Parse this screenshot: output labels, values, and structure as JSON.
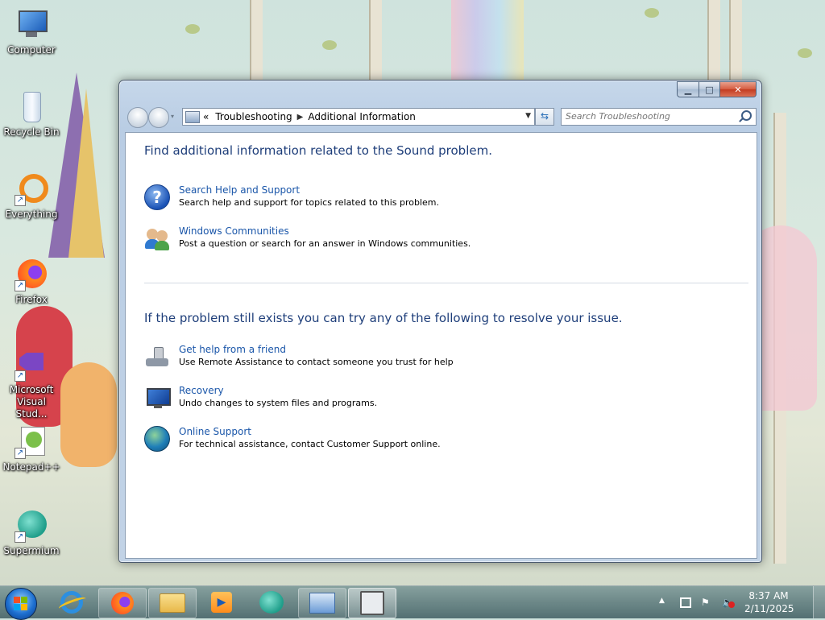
{
  "desktop": {
    "icons": [
      {
        "label": "Computer"
      },
      {
        "label": "Recycle Bin"
      },
      {
        "label": "Everything"
      },
      {
        "label": "Firefox"
      },
      {
        "label": "Microsoft Visual Stud..."
      },
      {
        "label": "Notepad++"
      },
      {
        "label": "Supermium"
      }
    ]
  },
  "window": {
    "breadcrumb": {
      "overflow": "«",
      "items": [
        "Troubleshooting",
        "Additional Information"
      ]
    },
    "search_placeholder": "Search Troubleshooting",
    "section1": {
      "heading": "Find additional information related to the Sound problem.",
      "items": [
        {
          "icon": "help-icon",
          "title": "Search Help and Support",
          "description": "Search help and support for topics related to this problem."
        },
        {
          "icon": "communities-icon",
          "title": "Windows Communities",
          "description": "Post a question or search for an answer in Windows communities."
        }
      ]
    },
    "section2": {
      "heading": "If the problem still exists you can try any of the following to resolve your issue.",
      "items": [
        {
          "icon": "remote-assistance-icon",
          "title": "Get help from a friend",
          "description": "Use Remote Assistance to contact someone you trust for help"
        },
        {
          "icon": "recovery-icon",
          "title": "Recovery",
          "description": "Undo changes to system files and programs."
        },
        {
          "icon": "globe-icon",
          "title": "Online Support",
          "description": "For technical assistance, contact Customer Support online."
        }
      ]
    }
  },
  "taskbar": {
    "items": [
      "start-button",
      "internet-explorer",
      "firefox",
      "file-explorer",
      "media-player",
      "supermium",
      "control-panel",
      "troubleshooting-window"
    ],
    "clock": {
      "time": "8:37 AM",
      "date": "2/11/2025"
    }
  },
  "colors": {
    "link": "#1a56a9",
    "heading": "#1e3e7a",
    "window_frame": "#b9cde4"
  }
}
